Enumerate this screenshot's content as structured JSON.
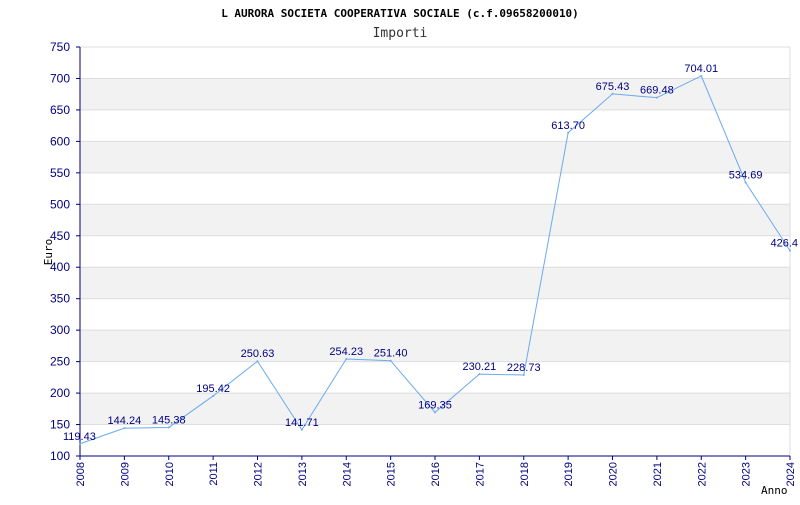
{
  "chart_data": {
    "type": "line",
    "title": "L AURORA SOCIETA COOPERATIVA SOCIALE (c.f.09658200010)",
    "subtitle": "Importi",
    "xlabel": "Anno",
    "ylabel": "Euro",
    "ylim": [
      100,
      750
    ],
    "ystep": 50,
    "grid": true,
    "categories": [
      "2008",
      "2009",
      "2010",
      "2011",
      "2012",
      "2013",
      "2014",
      "2015",
      "2016",
      "2017",
      "2018",
      "2019",
      "2020",
      "2021",
      "2022",
      "2023",
      "2024"
    ],
    "series": [
      {
        "values": [
          119.43,
          144.24,
          145.38,
          195.42,
          250.63,
          141.71,
          254.23,
          251.4,
          169.35,
          230.21,
          228.73,
          613.7,
          675.43,
          669.48,
          704.01,
          534.69,
          426.4
        ],
        "labels": [
          "119.43",
          "144.24",
          "145.38",
          "195.42",
          "250.63",
          "141.71",
          "254.23",
          "251.40",
          "169.35",
          "230.21",
          "228.73",
          "613.70",
          "675.43",
          "669.48",
          "704.01",
          "534.69",
          "426.4"
        ]
      }
    ],
    "colors": {
      "line": "#6aaaf0",
      "band": "#f2f2f2",
      "grid": "#dddddd",
      "tick_text": "#000080",
      "label_text": "#000080"
    }
  }
}
